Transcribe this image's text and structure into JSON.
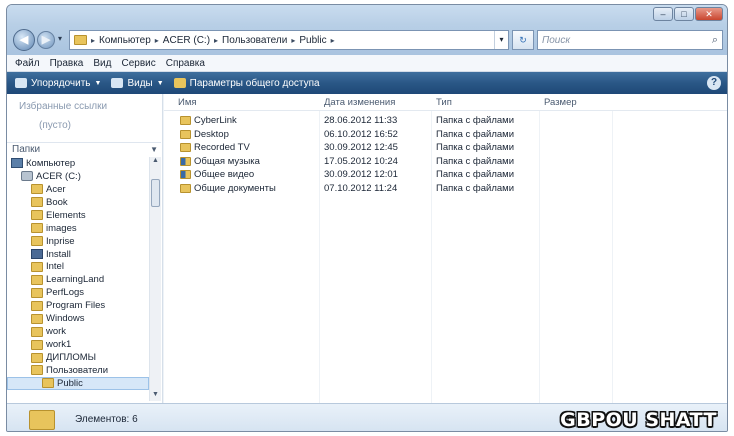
{
  "window": {
    "title": "",
    "controls": {
      "minimize": "–",
      "maximize": "□",
      "close": "✕"
    }
  },
  "address_bar": {
    "back_glyph": "◀",
    "forward_glyph": "▶",
    "dropdown_glyph": "▾",
    "crumbs": [
      "Компьютер",
      "ACER (C:)",
      "Пользователи",
      "Public"
    ],
    "separator": "▸",
    "refresh_glyph": "↻",
    "search_placeholder": "Поиск",
    "search_icon": "search-icon"
  },
  "menu": [
    "Файл",
    "Правка",
    "Вид",
    "Сервис",
    "Справка"
  ],
  "toolbar": {
    "organize_label": "Упорядочить",
    "views_label": "Виды",
    "share_label": "Параметры общего доступа",
    "help_glyph": "?"
  },
  "navpane": {
    "favorites_header": "Избранные ссылки",
    "favorites_empty": "(пусто)",
    "folders_header": "Папки",
    "tree": [
      {
        "label": "Компьютер",
        "icon": "computer-icon",
        "indent": 0
      },
      {
        "label": "ACER (C:)",
        "icon": "drive-icon",
        "indent": 1
      },
      {
        "label": "Acer",
        "icon": "folder-icon",
        "indent": 2
      },
      {
        "label": "Book",
        "icon": "folder-icon",
        "indent": 2
      },
      {
        "label": "Elements",
        "icon": "folder-icon",
        "indent": 2
      },
      {
        "label": "images",
        "icon": "folder-icon",
        "indent": 2
      },
      {
        "label": "Inprise",
        "icon": "folder-icon",
        "indent": 2
      },
      {
        "label": "Install",
        "icon": "install-icon",
        "indent": 2
      },
      {
        "label": "Intel",
        "icon": "folder-icon",
        "indent": 2
      },
      {
        "label": "LearningLand",
        "icon": "folder-icon",
        "indent": 2
      },
      {
        "label": "PerfLogs",
        "icon": "folder-icon",
        "indent": 2
      },
      {
        "label": "Program Files",
        "icon": "folder-icon",
        "indent": 2
      },
      {
        "label": "Windows",
        "icon": "folder-icon",
        "indent": 2
      },
      {
        "label": "work",
        "icon": "folder-icon",
        "indent": 2
      },
      {
        "label": "work1",
        "icon": "folder-icon",
        "indent": 2
      },
      {
        "label": "ДИПЛОМЫ",
        "icon": "folder-icon",
        "indent": 2
      },
      {
        "label": "Пользователи",
        "icon": "folder-icon",
        "indent": 2
      },
      {
        "label": "Public",
        "icon": "folder-icon",
        "indent": 3,
        "selected": true
      }
    ]
  },
  "content": {
    "columns": [
      "Имя",
      "Дата изменения",
      "Тип",
      "Размер"
    ],
    "rows": [
      {
        "name": "CyberLink",
        "date": "28.06.2012 11:33",
        "type": "Папка с файлами",
        "size": "",
        "icon": "folder-icon"
      },
      {
        "name": "Desktop",
        "date": "06.10.2012 16:52",
        "type": "Папка с файлами",
        "size": "",
        "icon": "folder-icon"
      },
      {
        "name": "Recorded TV",
        "date": "30.09.2012 12:45",
        "type": "Папка с файлами",
        "size": "",
        "icon": "folder-icon"
      },
      {
        "name": "Общая музыка",
        "date": "17.05.2012 10:24",
        "type": "Папка с файлами",
        "size": "",
        "icon": "music-folder-icon"
      },
      {
        "name": "Общее видео",
        "date": "30.09.2012 12:01",
        "type": "Папка с файлами",
        "size": "",
        "icon": "video-folder-icon"
      },
      {
        "name": "Общие документы",
        "date": "07.10.2012 11:24",
        "type": "Папка с файлами",
        "size": "",
        "icon": "folder-icon"
      }
    ]
  },
  "statusbar": {
    "items_text": "Элементов: 6"
  },
  "watermark": "GBPOU SHATT",
  "colors": {
    "toolbar": "#2a5786",
    "folder": "#e8c45c",
    "selection": "#d6e7f8"
  }
}
